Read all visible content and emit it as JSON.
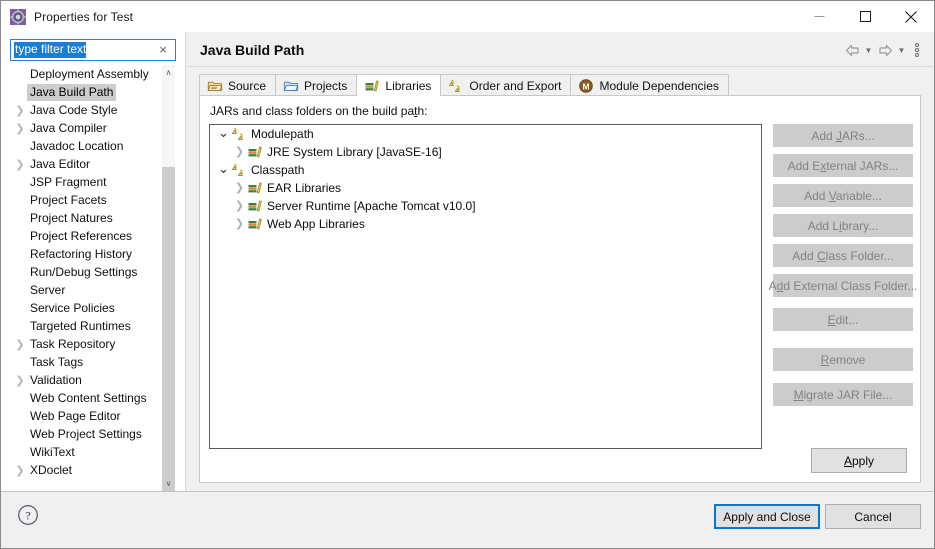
{
  "window": {
    "title": "Properties for Test",
    "icon": "eclipse-properties-gear-icon",
    "minimize_label": "Minimize",
    "maximize_label": "Maximize",
    "close_label": "Close"
  },
  "filter": {
    "value": "type filter text",
    "placeholder": "type filter text",
    "clear_label": "×",
    "selected": true
  },
  "sidebar": {
    "items": [
      {
        "label": "Deployment Assembly",
        "expandable": false,
        "selected": false
      },
      {
        "label": "Java Build Path",
        "expandable": false,
        "selected": true
      },
      {
        "label": "Java Code Style",
        "expandable": true,
        "selected": false
      },
      {
        "label": "Java Compiler",
        "expandable": true,
        "selected": false
      },
      {
        "label": "Javadoc Location",
        "expandable": false,
        "selected": false
      },
      {
        "label": "Java Editor",
        "expandable": true,
        "selected": false
      },
      {
        "label": "JSP Fragment",
        "expandable": false,
        "selected": false
      },
      {
        "label": "Project Facets",
        "expandable": false,
        "selected": false
      },
      {
        "label": "Project Natures",
        "expandable": false,
        "selected": false
      },
      {
        "label": "Project References",
        "expandable": false,
        "selected": false
      },
      {
        "label": "Refactoring History",
        "expandable": false,
        "selected": false
      },
      {
        "label": "Run/Debug Settings",
        "expandable": false,
        "selected": false
      },
      {
        "label": "Server",
        "expandable": false,
        "selected": false
      },
      {
        "label": "Service Policies",
        "expandable": false,
        "selected": false
      },
      {
        "label": "Targeted Runtimes",
        "expandable": false,
        "selected": false
      },
      {
        "label": "Task Repository",
        "expandable": true,
        "selected": false
      },
      {
        "label": "Task Tags",
        "expandable": false,
        "selected": false
      },
      {
        "label": "Validation",
        "expandable": true,
        "selected": false
      },
      {
        "label": "Web Content Settings",
        "expandable": false,
        "selected": false
      },
      {
        "label": "Web Page Editor",
        "expandable": false,
        "selected": false
      },
      {
        "label": "Web Project Settings",
        "expandable": false,
        "selected": false
      },
      {
        "label": "WikiText",
        "expandable": false,
        "selected": false
      },
      {
        "label": "XDoclet",
        "expandable": true,
        "selected": false
      }
    ],
    "scrollbar": {
      "up_arrow": "∧",
      "down_arrow": "∨"
    }
  },
  "page": {
    "title": "Java Build Path",
    "toolbar": {
      "back_icon": "back-arrow-icon",
      "back_menu_icon": "chevron-down-icon",
      "forward_icon": "forward-arrow-icon",
      "forward_menu_icon": "chevron-down-icon",
      "menu_icon": "vertical-dots-menu-icon"
    }
  },
  "tabs": [
    {
      "label": "Source",
      "icon": "source-folder-icon",
      "active": false
    },
    {
      "label": "Projects",
      "icon": "projects-folder-icon",
      "active": false
    },
    {
      "label": "Libraries",
      "icon": "libraries-books-icon",
      "active": true
    },
    {
      "label": "Order and Export",
      "icon": "order-export-arrows-icon",
      "active": false
    },
    {
      "label": "Module Dependencies",
      "icon": "module-circle-m-icon",
      "active": false
    }
  ],
  "libraries": {
    "description": "JARs and class folders on the build path:",
    "description_mnemonic": "t",
    "tree": [
      {
        "label": "Modulepath",
        "icon": "modulepath-arrows-icon",
        "level": 0,
        "expanded": true,
        "twisty": "⌄"
      },
      {
        "label": "JRE System Library [JavaSE-16]",
        "icon": "library-books-icon",
        "level": 1,
        "expanded": false,
        "twisty": "›"
      },
      {
        "label": "Classpath",
        "icon": "classpath-arrows-icon",
        "level": 0,
        "expanded": true,
        "twisty": "⌄"
      },
      {
        "label": "EAR Libraries",
        "icon": "library-books-icon",
        "level": 1,
        "expanded": false,
        "twisty": "›"
      },
      {
        "label": "Server Runtime [Apache Tomcat v10.0]",
        "icon": "library-books-icon",
        "level": 1,
        "expanded": false,
        "twisty": "›"
      },
      {
        "label": "Web App Libraries",
        "icon": "library-books-icon",
        "level": 1,
        "expanded": false,
        "twisty": "›"
      }
    ],
    "buttons": [
      {
        "label": "Add JARs...",
        "mnemonic": "J",
        "enabled": false,
        "group": 1
      },
      {
        "label": "Add External JARs...",
        "mnemonic": "x",
        "enabled": false,
        "group": 1
      },
      {
        "label": "Add Variable...",
        "mnemonic": "V",
        "enabled": false,
        "group": 1
      },
      {
        "label": "Add Library...",
        "mnemonic": "i",
        "enabled": false,
        "group": 1
      },
      {
        "label": "Add Class Folder...",
        "mnemonic": "C",
        "enabled": false,
        "group": 1
      },
      {
        "label": "Add External Class Folder...",
        "mnemonic": "d",
        "enabled": false,
        "group": 1
      },
      {
        "label": "Edit...",
        "mnemonic": "E",
        "enabled": false,
        "group": 2
      },
      {
        "label": "Remove",
        "mnemonic": "R",
        "enabled": false,
        "group": 2
      },
      {
        "label": "Migrate JAR File...",
        "mnemonic": "M",
        "enabled": false,
        "group": 3
      }
    ]
  },
  "actions": {
    "apply": "Apply",
    "apply_mnemonic": "A",
    "apply_and_close": "Apply and Close",
    "cancel": "Cancel",
    "help_icon": "help-question-icon"
  },
  "colors": {
    "accent": "#0078d7",
    "selection": "#1a7ed6",
    "tree_selection": "#cdcdcd",
    "disabled_button": "#cccccc",
    "disabled_text": "#828282",
    "panel": "#f0f0f0",
    "white": "#ffffff"
  }
}
